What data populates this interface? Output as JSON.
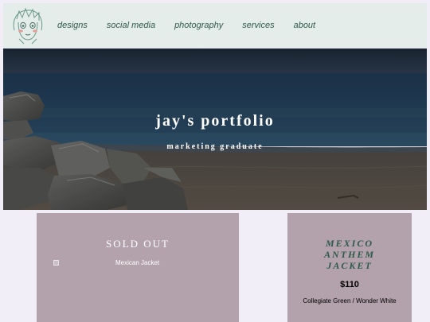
{
  "nav": {
    "logo_icon": "anime-portrait-logo-icon",
    "items": [
      {
        "label": "designs"
      },
      {
        "label": "social media"
      },
      {
        "label": "photography"
      },
      {
        "label": "services"
      },
      {
        "label": "about"
      }
    ],
    "link_color": "#2f5a4a",
    "background": "#e4ede9"
  },
  "hero": {
    "title": "jay's portfolio",
    "subtitle": "marketing graduate",
    "image": "beach-rocks-photo"
  },
  "products": {
    "left": {
      "badge": "SOLD OUT",
      "image_alt": "Mexican Jacket",
      "broken_image_icon": "broken-image-icon"
    },
    "right": {
      "title_line1": "MEXICO",
      "title_line2": "ANTHEM",
      "title_line3": "JACKET",
      "price": "$110",
      "color": "Collegiate Green / Wonder White"
    }
  },
  "colors": {
    "card_bg": "#b3a2ab",
    "page_bg": "#f1eef7",
    "accent_green": "#2f5a4a"
  }
}
